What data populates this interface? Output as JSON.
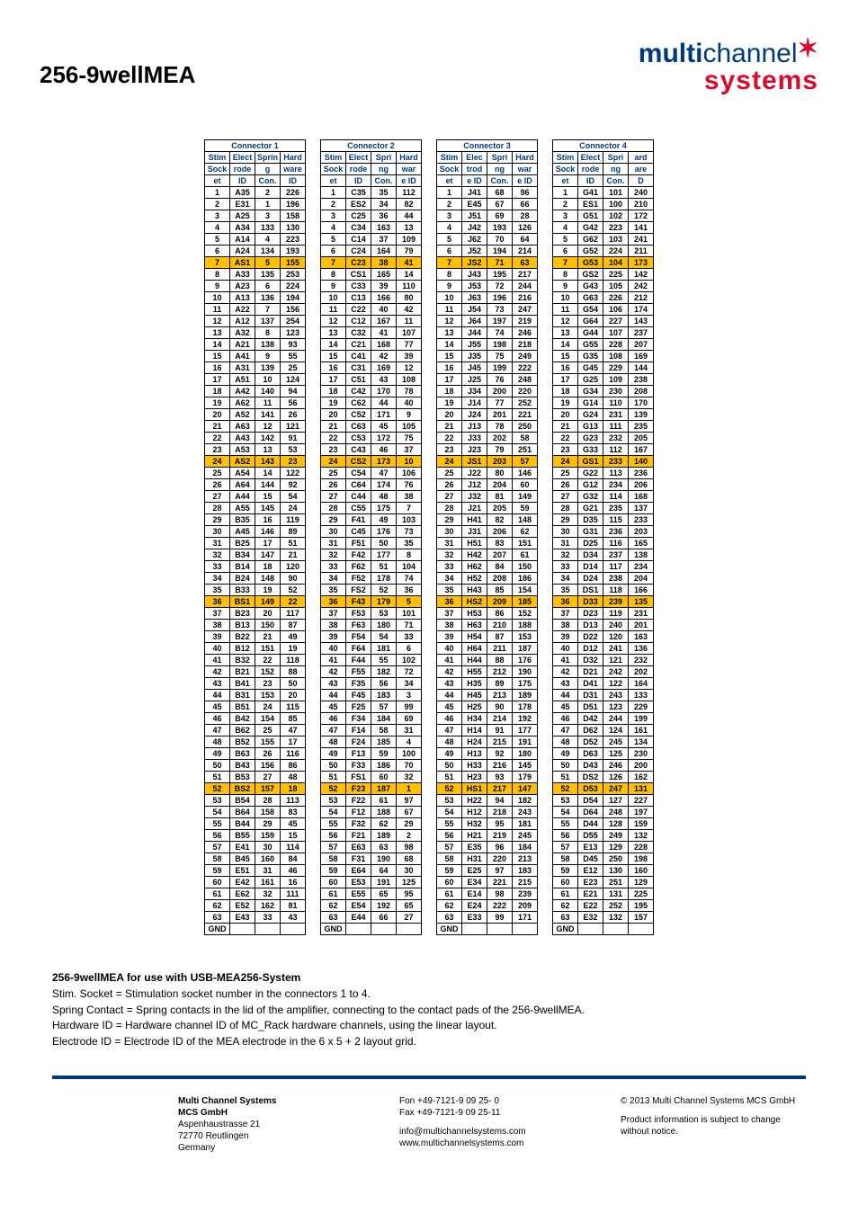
{
  "title": "256-9wellMEA",
  "logo": {
    "line1a": "multi",
    "line1b": "channel",
    "line2": "systems"
  },
  "headers_groups": [
    "Connector 1",
    "Connector 2",
    "Connector 3",
    "Connector 4"
  ],
  "col_h1": [
    "Stim",
    "Elect",
    "Sprin",
    "Hard"
  ],
  "col_h2": [
    "Sock",
    "rode",
    "g",
    "ware"
  ],
  "col_h3": [
    "et",
    "ID",
    "Con.",
    "ID"
  ],
  "col_h1b": [
    "Stim",
    "Elect",
    "Spri",
    "Hard"
  ],
  "col_h2b": [
    "Sock",
    "rode",
    "ng",
    "war"
  ],
  "col_h3b": [
    "et",
    "ID",
    "Con.",
    "e ID"
  ],
  "col_h1c": [
    "Stim",
    "Elec",
    "Spri",
    "Hard"
  ],
  "col_h2c": [
    "Sock",
    "trod",
    "ng",
    "war"
  ],
  "col_h3c": [
    "et",
    "e ID",
    "Con.",
    "e ID"
  ],
  "col_h1d": [
    "Stim",
    "Elect",
    "Spri",
    "ard"
  ],
  "col_h2d": [
    "Sock",
    "rode",
    "ng",
    "are"
  ],
  "col_h3d": [
    "et",
    "ID",
    "Con.",
    "D"
  ],
  "highlight_rows": [
    7,
    24,
    36,
    52
  ],
  "conn1": [
    [
      1,
      "A35",
      2,
      226
    ],
    [
      2,
      "E31",
      1,
      196
    ],
    [
      3,
      "A25",
      3,
      158
    ],
    [
      4,
      "A34",
      133,
      130
    ],
    [
      5,
      "A14",
      4,
      223
    ],
    [
      6,
      "A24",
      134,
      193
    ],
    [
      7,
      "AS1",
      5,
      155
    ],
    [
      8,
      "A33",
      135,
      253
    ],
    [
      9,
      "A23",
      6,
      224
    ],
    [
      10,
      "A13",
      136,
      194
    ],
    [
      11,
      "A22",
      7,
      156
    ],
    [
      12,
      "A12",
      137,
      254
    ],
    [
      13,
      "A32",
      8,
      123
    ],
    [
      14,
      "A21",
      138,
      93
    ],
    [
      15,
      "A41",
      9,
      55
    ],
    [
      16,
      "A31",
      139,
      25
    ],
    [
      17,
      "A51",
      10,
      124
    ],
    [
      18,
      "A42",
      140,
      94
    ],
    [
      19,
      "A62",
      11,
      56
    ],
    [
      20,
      "A52",
      141,
      26
    ],
    [
      21,
      "A63",
      12,
      121
    ],
    [
      22,
      "A43",
      142,
      91
    ],
    [
      23,
      "A53",
      13,
      53
    ],
    [
      24,
      "AS2",
      143,
      23
    ],
    [
      25,
      "A54",
      14,
      122
    ],
    [
      26,
      "A64",
      144,
      92
    ],
    [
      27,
      "A44",
      15,
      54
    ],
    [
      28,
      "A55",
      145,
      24
    ],
    [
      29,
      "B35",
      16,
      119
    ],
    [
      30,
      "A45",
      146,
      89
    ],
    [
      31,
      "B25",
      17,
      51
    ],
    [
      32,
      "B34",
      147,
      21
    ],
    [
      33,
      "B14",
      18,
      120
    ],
    [
      34,
      "B24",
      148,
      90
    ],
    [
      35,
      "B33",
      19,
      52
    ],
    [
      36,
      "BS1",
      149,
      22
    ],
    [
      37,
      "B23",
      20,
      117
    ],
    [
      38,
      "B13",
      150,
      87
    ],
    [
      39,
      "B22",
      21,
      49
    ],
    [
      40,
      "B12",
      151,
      19
    ],
    [
      41,
      "B32",
      22,
      118
    ],
    [
      42,
      "B21",
      152,
      88
    ],
    [
      43,
      "B41",
      23,
      50
    ],
    [
      44,
      "B31",
      153,
      20
    ],
    [
      45,
      "B51",
      24,
      115
    ],
    [
      46,
      "B42",
      154,
      85
    ],
    [
      47,
      "B62",
      25,
      47
    ],
    [
      48,
      "B52",
      155,
      17
    ],
    [
      49,
      "B63",
      26,
      116
    ],
    [
      50,
      "B43",
      156,
      86
    ],
    [
      51,
      "B53",
      27,
      48
    ],
    [
      52,
      "BS2",
      157,
      18
    ],
    [
      53,
      "B54",
      28,
      113
    ],
    [
      54,
      "B64",
      158,
      83
    ],
    [
      55,
      "B44",
      29,
      45
    ],
    [
      56,
      "B55",
      159,
      15
    ],
    [
      57,
      "E41",
      30,
      114
    ],
    [
      58,
      "B45",
      160,
      84
    ],
    [
      59,
      "E51",
      31,
      46
    ],
    [
      60,
      "E42",
      161,
      16
    ],
    [
      61,
      "E62",
      32,
      111
    ],
    [
      62,
      "E52",
      162,
      81
    ],
    [
      63,
      "E43",
      33,
      43
    ],
    [
      "GND",
      "",
      "",
      ""
    ]
  ],
  "conn2": [
    [
      1,
      "C35",
      35,
      112
    ],
    [
      2,
      "ES2",
      34,
      82
    ],
    [
      3,
      "C25",
      36,
      44
    ],
    [
      4,
      "C34",
      163,
      13
    ],
    [
      5,
      "C14",
      37,
      109
    ],
    [
      6,
      "C24",
      164,
      79
    ],
    [
      7,
      "C23",
      38,
      41
    ],
    [
      8,
      "CS1",
      165,
      14
    ],
    [
      9,
      "C33",
      39,
      110
    ],
    [
      10,
      "C13",
      166,
      80
    ],
    [
      11,
      "C22",
      40,
      42
    ],
    [
      12,
      "C12",
      167,
      11
    ],
    [
      13,
      "C32",
      41,
      107
    ],
    [
      14,
      "C21",
      168,
      77
    ],
    [
      15,
      "C41",
      42,
      39
    ],
    [
      16,
      "C31",
      169,
      12
    ],
    [
      17,
      "C51",
      43,
      108
    ],
    [
      18,
      "C42",
      170,
      78
    ],
    [
      19,
      "C62",
      44,
      40
    ],
    [
      20,
      "C52",
      171,
      9
    ],
    [
      21,
      "C63",
      45,
      105
    ],
    [
      22,
      "C53",
      172,
      75
    ],
    [
      23,
      "C43",
      46,
      37
    ],
    [
      24,
      "CS2",
      173,
      10
    ],
    [
      25,
      "C54",
      47,
      106
    ],
    [
      26,
      "C64",
      174,
      76
    ],
    [
      27,
      "C44",
      48,
      38
    ],
    [
      28,
      "C55",
      175,
      7
    ],
    [
      29,
      "F41",
      49,
      103
    ],
    [
      30,
      "C45",
      176,
      73
    ],
    [
      31,
      "F51",
      50,
      35
    ],
    [
      32,
      "F42",
      177,
      8
    ],
    [
      33,
      "F62",
      51,
      104
    ],
    [
      34,
      "F52",
      178,
      74
    ],
    [
      35,
      "FS2",
      52,
      36
    ],
    [
      36,
      "F43",
      179,
      5
    ],
    [
      37,
      "F53",
      53,
      101
    ],
    [
      38,
      "F63",
      180,
      71
    ],
    [
      39,
      "F54",
      54,
      33
    ],
    [
      40,
      "F64",
      181,
      6
    ],
    [
      41,
      "F44",
      55,
      102
    ],
    [
      42,
      "F55",
      182,
      72
    ],
    [
      43,
      "F35",
      56,
      34
    ],
    [
      44,
      "F45",
      183,
      3
    ],
    [
      45,
      "F25",
      57,
      99
    ],
    [
      46,
      "F34",
      184,
      69
    ],
    [
      47,
      "F14",
      58,
      31
    ],
    [
      48,
      "F24",
      185,
      4
    ],
    [
      49,
      "F13",
      59,
      100
    ],
    [
      50,
      "F33",
      186,
      70
    ],
    [
      51,
      "FS1",
      60,
      32
    ],
    [
      52,
      "F23",
      187,
      1
    ],
    [
      53,
      "F22",
      61,
      97
    ],
    [
      54,
      "F12",
      188,
      67
    ],
    [
      55,
      "F32",
      62,
      29
    ],
    [
      56,
      "F21",
      189,
      2
    ],
    [
      57,
      "E63",
      63,
      98
    ],
    [
      58,
      "F31",
      190,
      68
    ],
    [
      59,
      "E64",
      64,
      30
    ],
    [
      60,
      "E53",
      191,
      125
    ],
    [
      61,
      "E55",
      65,
      95
    ],
    [
      62,
      "E54",
      192,
      65
    ],
    [
      63,
      "E44",
      66,
      27
    ],
    [
      "GND",
      "",
      "",
      ""
    ]
  ],
  "conn3": [
    [
      1,
      "J41",
      68,
      96
    ],
    [
      2,
      "E45",
      67,
      66
    ],
    [
      3,
      "J51",
      69,
      28
    ],
    [
      4,
      "J42",
      193,
      126
    ],
    [
      5,
      "J62",
      70,
      64
    ],
    [
      6,
      "J52",
      194,
      214
    ],
    [
      7,
      "JS2",
      71,
      63
    ],
    [
      8,
      "J43",
      195,
      217
    ],
    [
      9,
      "J53",
      72,
      244
    ],
    [
      10,
      "J63",
      196,
      216
    ],
    [
      11,
      "J54",
      73,
      247
    ],
    [
      12,
      "J64",
      197,
      219
    ],
    [
      13,
      "J44",
      74,
      246
    ],
    [
      14,
      "J55",
      198,
      218
    ],
    [
      15,
      "J35",
      75,
      249
    ],
    [
      16,
      "J45",
      199,
      222
    ],
    [
      17,
      "J25",
      76,
      248
    ],
    [
      18,
      "J34",
      200,
      220
    ],
    [
      19,
      "J14",
      77,
      252
    ],
    [
      20,
      "J24",
      201,
      221
    ],
    [
      21,
      "J13",
      78,
      250
    ],
    [
      22,
      "J33",
      202,
      58
    ],
    [
      23,
      "J23",
      79,
      251
    ],
    [
      24,
      "JS1",
      203,
      57
    ],
    [
      25,
      "J22",
      80,
      146
    ],
    [
      26,
      "J12",
      204,
      60
    ],
    [
      27,
      "J32",
      81,
      149
    ],
    [
      28,
      "J21",
      205,
      59
    ],
    [
      29,
      "H41",
      82,
      148
    ],
    [
      30,
      "J31",
      206,
      62
    ],
    [
      31,
      "H51",
      83,
      151
    ],
    [
      32,
      "H42",
      207,
      61
    ],
    [
      33,
      "H62",
      84,
      150
    ],
    [
      34,
      "H52",
      208,
      186
    ],
    [
      35,
      "H43",
      85,
      154
    ],
    [
      36,
      "HS2",
      209,
      185
    ],
    [
      37,
      "H53",
      86,
      152
    ],
    [
      38,
      "H63",
      210,
      188
    ],
    [
      39,
      "H54",
      87,
      153
    ],
    [
      40,
      "H64",
      211,
      187
    ],
    [
      41,
      "H44",
      88,
      176
    ],
    [
      42,
      "H55",
      212,
      190
    ],
    [
      43,
      "H35",
      89,
      175
    ],
    [
      44,
      "H45",
      213,
      189
    ],
    [
      45,
      "H25",
      90,
      178
    ],
    [
      46,
      "H34",
      214,
      192
    ],
    [
      47,
      "H14",
      91,
      177
    ],
    [
      48,
      "H24",
      215,
      191
    ],
    [
      49,
      "H13",
      92,
      180
    ],
    [
      50,
      "H33",
      216,
      145
    ],
    [
      51,
      "H23",
      93,
      179
    ],
    [
      52,
      "HS1",
      217,
      147
    ],
    [
      53,
      "H22",
      94,
      182
    ],
    [
      54,
      "H12",
      218,
      243
    ],
    [
      55,
      "H32",
      95,
      181
    ],
    [
      56,
      "H21",
      219,
      245
    ],
    [
      57,
      "E35",
      96,
      184
    ],
    [
      58,
      "H31",
      220,
      213
    ],
    [
      59,
      "E25",
      97,
      183
    ],
    [
      60,
      "E34",
      221,
      215
    ],
    [
      61,
      "E14",
      98,
      239
    ],
    [
      62,
      "E24",
      222,
      209
    ],
    [
      63,
      "E33",
      99,
      171
    ],
    [
      "GND",
      "",
      "",
      ""
    ]
  ],
  "conn4": [
    [
      1,
      "G41",
      101,
      240
    ],
    [
      2,
      "ES1",
      100,
      210
    ],
    [
      3,
      "G51",
      102,
      172
    ],
    [
      4,
      "G42",
      223,
      141
    ],
    [
      5,
      "G62",
      103,
      241
    ],
    [
      6,
      "G52",
      224,
      211
    ],
    [
      7,
      "G53",
      104,
      173
    ],
    [
      8,
      "GS2",
      225,
      142
    ],
    [
      9,
      "G43",
      105,
      242
    ],
    [
      10,
      "G63",
      226,
      212
    ],
    [
      11,
      "G54",
      106,
      174
    ],
    [
      12,
      "G64",
      227,
      143
    ],
    [
      13,
      "G44",
      107,
      237
    ],
    [
      14,
      "G55",
      228,
      207
    ],
    [
      15,
      "G35",
      108,
      169
    ],
    [
      16,
      "G45",
      229,
      144
    ],
    [
      17,
      "G25",
      109,
      238
    ],
    [
      18,
      "G34",
      230,
      208
    ],
    [
      19,
      "G14",
      110,
      170
    ],
    [
      20,
      "G24",
      231,
      139
    ],
    [
      21,
      "G13",
      111,
      235
    ],
    [
      22,
      "G23",
      232,
      205
    ],
    [
      23,
      "G33",
      112,
      167
    ],
    [
      24,
      "GS1",
      233,
      140
    ],
    [
      25,
      "G22",
      113,
      236
    ],
    [
      26,
      "G12",
      234,
      206
    ],
    [
      27,
      "G32",
      114,
      168
    ],
    [
      28,
      "G21",
      235,
      137
    ],
    [
      29,
      "D35",
      115,
      233
    ],
    [
      30,
      "G31",
      236,
      203
    ],
    [
      31,
      "D25",
      116,
      165
    ],
    [
      32,
      "D34",
      237,
      138
    ],
    [
      33,
      "D14",
      117,
      234
    ],
    [
      34,
      "D24",
      238,
      204
    ],
    [
      35,
      "DS1",
      118,
      166
    ],
    [
      36,
      "D33",
      239,
      135
    ],
    [
      37,
      "D23",
      119,
      231
    ],
    [
      38,
      "D13",
      240,
      201
    ],
    [
      39,
      "D22",
      120,
      163
    ],
    [
      40,
      "D12",
      241,
      136
    ],
    [
      41,
      "D32",
      121,
      232
    ],
    [
      42,
      "D21",
      242,
      202
    ],
    [
      43,
      "D41",
      122,
      164
    ],
    [
      44,
      "D31",
      243,
      133
    ],
    [
      45,
      "D51",
      123,
      229
    ],
    [
      46,
      "D42",
      244,
      199
    ],
    [
      47,
      "D62",
      124,
      161
    ],
    [
      48,
      "D52",
      245,
      134
    ],
    [
      49,
      "D63",
      125,
      230
    ],
    [
      50,
      "D43",
      246,
      200
    ],
    [
      51,
      "DS2",
      126,
      162
    ],
    [
      52,
      "D53",
      247,
      131
    ],
    [
      53,
      "D54",
      127,
      227
    ],
    [
      54,
      "D64",
      248,
      197
    ],
    [
      55,
      "D44",
      128,
      159
    ],
    [
      56,
      "D55",
      249,
      132
    ],
    [
      57,
      "E13",
      129,
      228
    ],
    [
      58,
      "D45",
      250,
      198
    ],
    [
      59,
      "E12",
      130,
      160
    ],
    [
      60,
      "E23",
      251,
      129
    ],
    [
      61,
      "E21",
      131,
      225
    ],
    [
      62,
      "E22",
      252,
      195
    ],
    [
      63,
      "E32",
      132,
      157
    ],
    [
      "GND",
      "",
      "",
      ""
    ]
  ],
  "notes": {
    "title": "256-9wellMEA for use with USB-MEA256-System",
    "lines": [
      "Stim. Socket = Stimulation socket number in the connectors 1 to 4.",
      "Spring Contact = Spring contacts in the lid of the amplifier, connecting to the contact pads of the 256-9wellMEA.",
      "Hardware ID =  Hardware channel ID of MC_Rack hardware channels, using the linear layout.",
      "Electrode ID = Electrode ID of the MEA electrode in the 6 x 5 + 2 layout grid."
    ]
  },
  "footer": {
    "col1": [
      "Multi Channel Systems",
      "MCS GmbH",
      "Aspenhaustrasse 21",
      "72770 Reutlingen",
      "Germany"
    ],
    "col2a": [
      "Fon +49-7121-9 09 25- 0",
      "Fax +49-7121-9 09 25-11"
    ],
    "col2b": [
      "info@multichannelsystems.com",
      "www.multichannelsystems.com"
    ],
    "col3a": "© 2013 Multi Channel Systems MCS GmbH",
    "col3b": [
      "Product information is subject to change",
      "without notice."
    ]
  }
}
